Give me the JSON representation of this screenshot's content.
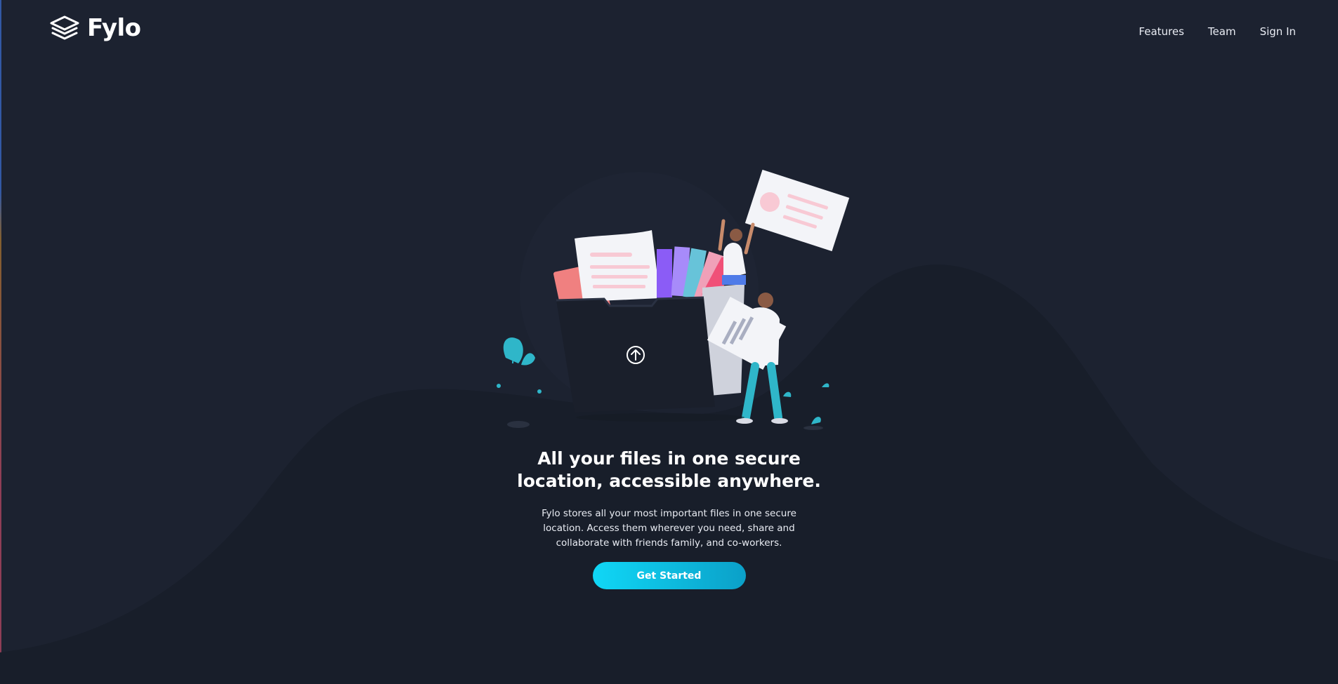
{
  "brand": {
    "name": "Fylo",
    "logo_icon": "stacked-layers-icon"
  },
  "nav": {
    "items": [
      {
        "label": "Features"
      },
      {
        "label": "Team"
      },
      {
        "label": "Sign In"
      }
    ]
  },
  "hero": {
    "illustration": "files-folder-upload-illustration",
    "title": "All your files in one secure location, accessible anywhere.",
    "description": "Fylo stores all your most important files in one secure location. Access them wherever you need, share and collaborate with friends family, and co-workers.",
    "cta_label": "Get Started"
  },
  "colors": {
    "background": "#1c2230",
    "wave": "#181e2a",
    "accent_start": "#10d7f6",
    "accent_end": "#0ba0c8",
    "text": "#ffffff"
  }
}
